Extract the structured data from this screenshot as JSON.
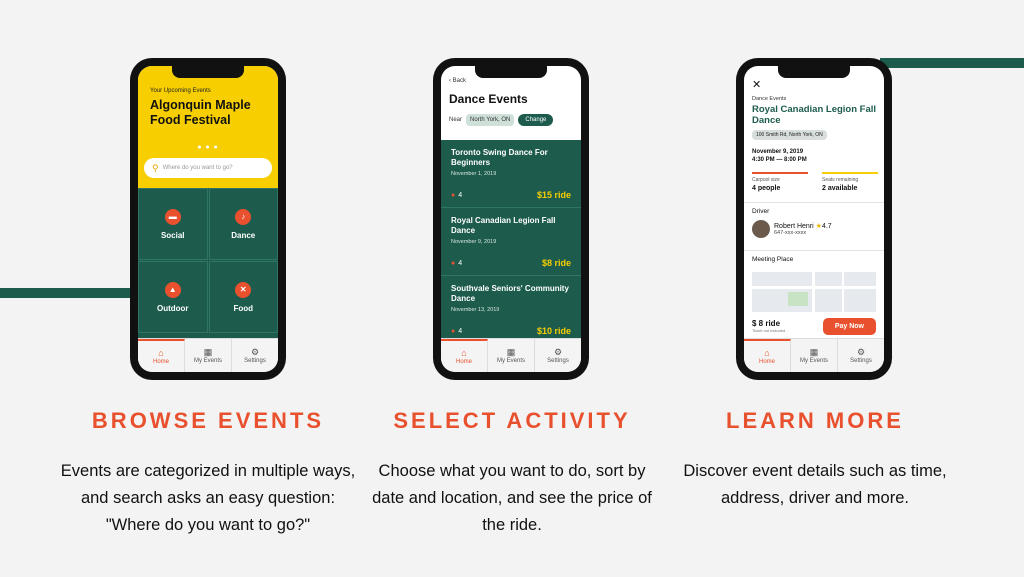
{
  "colors": {
    "accent": "#e8502e",
    "green": "#1d5c4d",
    "yellow": "#f7cf00"
  },
  "tabs": [
    {
      "label": "Home",
      "icon": "home-icon"
    },
    {
      "label": "My Events",
      "icon": "calendar-icon"
    },
    {
      "label": "Settings",
      "icon": "gear-icon"
    }
  ],
  "phone1": {
    "subtitle": "Your Upcoming Events",
    "title": "Algonquin Maple Food Festival",
    "search_placeholder": "Where do you want to go?",
    "categories": [
      "Social",
      "Dance",
      "Outdoor",
      "Food"
    ]
  },
  "phone2": {
    "back": "Back",
    "title": "Dance Events",
    "near_label": "Near",
    "location": "North York, ON",
    "change": "Change",
    "events": [
      {
        "title": "Toronto Swing Dance For Beginners",
        "date": "November 1, 2019",
        "count": "4",
        "price": "$15 ride"
      },
      {
        "title": "Royal Canadian Legion Fall Dance",
        "date": "November 9, 2019",
        "count": "4",
        "price": "$8 ride"
      },
      {
        "title": "Southvale Seniors' Community Dance",
        "date": "November 13, 2019",
        "count": "4",
        "price": "$10 ride"
      }
    ]
  },
  "phone3": {
    "subtitle": "Dance Events",
    "title": "Royal Canadian Legion Fall Dance",
    "address": "100 Smith Rd, North York, ON",
    "date": "November 9, 2019",
    "time": "4:30 PM — 8:00 PM",
    "carpool_label": "Carpool size",
    "carpool_value": "4 people",
    "seats_label": "Seats remaining",
    "seats_value": "2 available",
    "driver_label": "Driver",
    "driver_name": "Robert Henri",
    "driver_rating": "4.7",
    "driver_phone": "647-xxx-xxxx",
    "meeting_label": "Meeting Place",
    "price": "$ 8 ride",
    "price_note": "Ticket not included",
    "pay_button": "Pay Now"
  },
  "sections": [
    {
      "heading": "BROWSE EVENTS",
      "description": "Events are categorized in multiple ways, and search asks an easy question: \"Where do you want to go?\""
    },
    {
      "heading": "SELECT ACTIVITY",
      "description": "Choose what you want to do, sort by date and location, and see the price of the ride."
    },
    {
      "heading": "LEARN MORE",
      "description": "Discover event details such as time, address, driver and more."
    }
  ]
}
